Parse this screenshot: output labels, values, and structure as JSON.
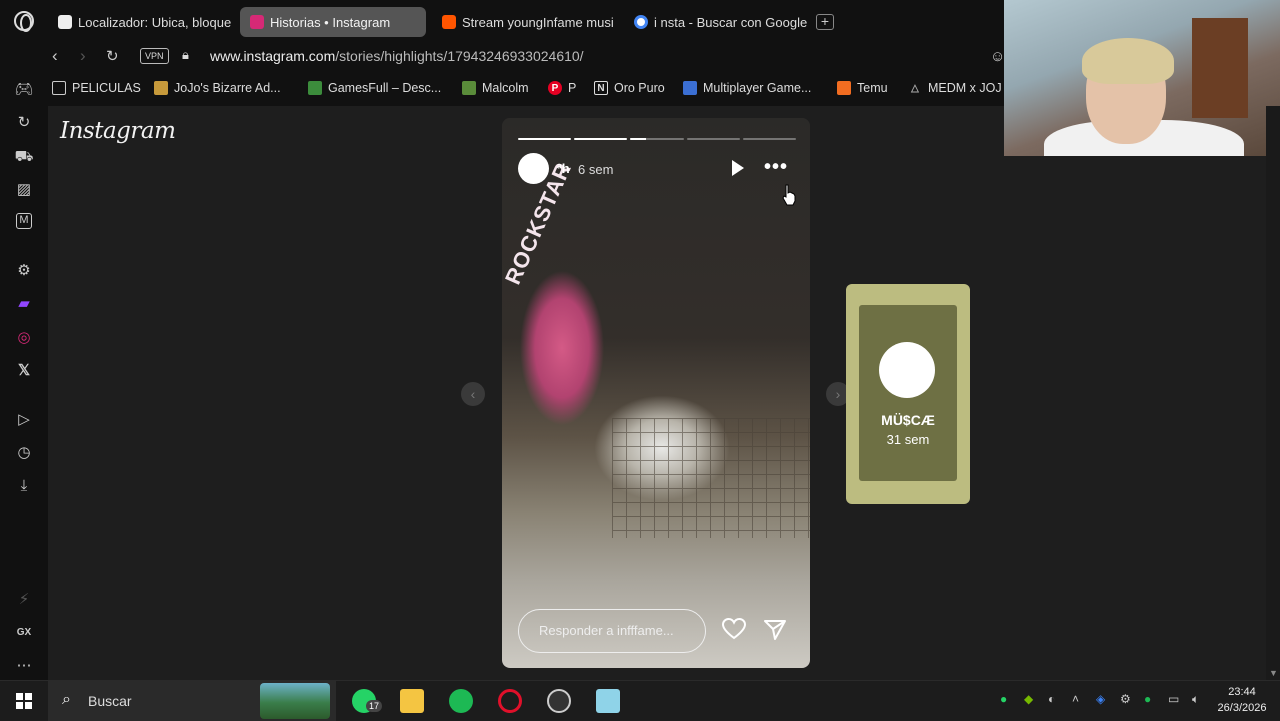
{
  "tabs": [
    {
      "label": "Localizador: Ubica, bloque",
      "active": false,
      "favicon_color": "#eee"
    },
    {
      "label": "Historias • Instagram",
      "active": true,
      "favicon_color": "#d62976"
    },
    {
      "label": "Stream youngInfame musi",
      "active": false,
      "favicon_color": "#ff5500"
    },
    {
      "label": "i nsta - Buscar con Google",
      "active": false,
      "favicon_color": "#4285f4"
    }
  ],
  "address": {
    "vpn_label": "VPN",
    "url_host": "www.instagram.com",
    "url_path": "/stories/highlights/17943246933024610/"
  },
  "bookmarks": [
    {
      "label": "PELICULAS",
      "icon": "folder-icon"
    },
    {
      "label": "JoJo's Bizarre Ad...",
      "icon": "jojo-icon"
    },
    {
      "label": "GamesFull – Desc...",
      "icon": "gamepad-icon"
    },
    {
      "label": "Malcolm",
      "icon": "malcolm-icon"
    },
    {
      "label": "P",
      "icon": "pinterest-icon"
    },
    {
      "label": "Oro Puro",
      "icon": "n-icon"
    },
    {
      "label": "Multiplayer Game...",
      "icon": "multiplayer-icon"
    },
    {
      "label": "Temu",
      "icon": "temu-icon"
    },
    {
      "label": "MEDM x JOJ",
      "icon": "triangle-icon"
    }
  ],
  "instagram": {
    "logo": "Instagram",
    "story": {
      "username": "ªh",
      "time": "6 sem",
      "progress_segments": 5,
      "active_segment": 2,
      "active_progress": 0.3,
      "reply_placeholder": "Responder a infffame...",
      "can_text": "ROCKSTAR"
    },
    "next_story": {
      "name": "MÜ$CÆ",
      "time": "31 sem"
    }
  },
  "taskbar": {
    "search_label": "Buscar",
    "whatsapp_badge": "17",
    "time": "23:44",
    "date": "26/3/2026"
  },
  "colors": {
    "accent_instagram": "#d62976",
    "story_pink": "#c84e7e",
    "next_story_bg": "#bcbc80"
  }
}
